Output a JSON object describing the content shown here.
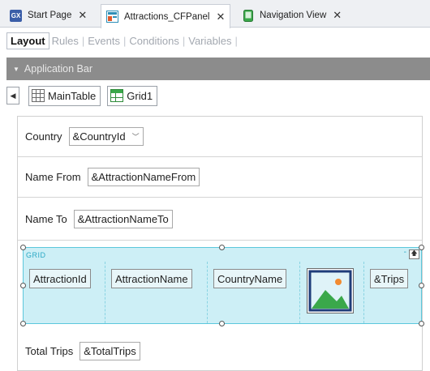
{
  "tabs": [
    {
      "label": "Start Page",
      "icon": "gx-icon",
      "active": false
    },
    {
      "label": "Attractions_CFPanel",
      "icon": "panel-icon",
      "active": true
    },
    {
      "label": "Navigation View",
      "icon": "phone-icon",
      "active": false
    }
  ],
  "close_glyph": "✕",
  "subtabs": [
    "Layout",
    "Rules",
    "Events",
    "Conditions",
    "Variables"
  ],
  "app_bar": {
    "label": "Application Bar"
  },
  "breadcrumb": {
    "items": [
      "MainTable",
      "Grid1"
    ]
  },
  "form": {
    "country": {
      "label": "Country",
      "value": "&CountryId"
    },
    "name_from": {
      "label": "Name From",
      "value": "&AttractionNameFrom"
    },
    "name_to": {
      "label": "Name To",
      "value": "&AttractionNameTo"
    },
    "total_trips": {
      "label": "Total Trips",
      "value": "&TotalTrips"
    }
  },
  "grid": {
    "title": "GRID",
    "minus": "-",
    "columns": [
      "AttractionId",
      "AttractionName",
      "CountryName",
      "image",
      "&Trips"
    ]
  },
  "colors": {
    "grid_bg": "#cdeff6",
    "grid_border": "#5cc8dc",
    "app_bar": "#8c8c8c"
  }
}
